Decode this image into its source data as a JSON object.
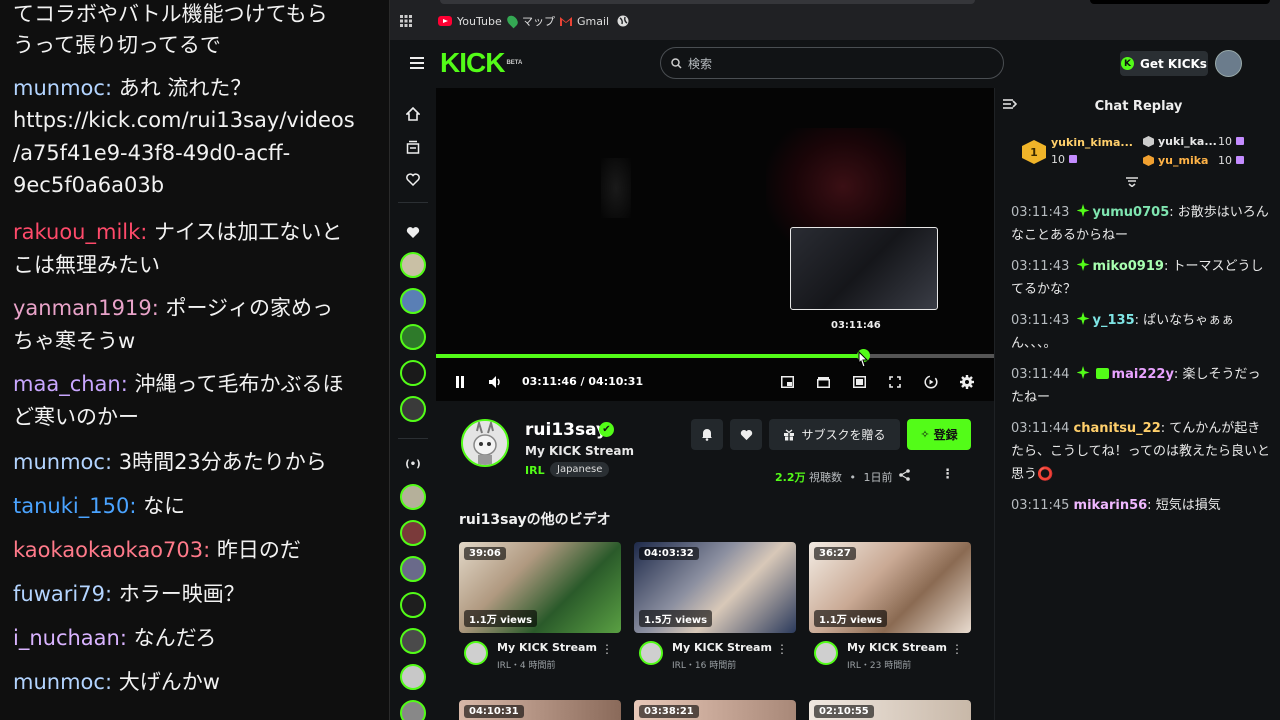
{
  "overlay_chat": {
    "messages": [
      {
        "user": "",
        "text": "てコラボやバトル機能つけてもら",
        "color": "#f2f2f2"
      },
      {
        "user": "",
        "text": "うって張り切ってるで",
        "color": "#f2f2f2"
      },
      {
        "user": "munmoc",
        "text": "あれ 流れた？",
        "color": "#b3d4ff"
      },
      {
        "user": "",
        "text": "https://kick.com/rui13say/videos",
        "color": "#f2f2f2"
      },
      {
        "user": "",
        "text": "/a75f41e9-43f8-49d0-acff-",
        "color": "#f2f2f2"
      },
      {
        "user": "",
        "text": "9ec5f0a6a03b",
        "color": "#f2f2f2"
      },
      {
        "user": "rakuou_milk",
        "text": "ナイスは加工ないと",
        "color": "#ff4a6a"
      },
      {
        "user": "",
        "text": "こは無理みたい",
        "color": "#f2f2f2"
      },
      {
        "user": "yanman1919",
        "text": "ポージィの家めっ",
        "color": "#e9a3c9"
      },
      {
        "user": "",
        "text": "ちゃ寒そうw",
        "color": "#f2f2f2"
      },
      {
        "user": "maa_chan",
        "text": "沖縄って毛布かぶるほ",
        "color": "#c9a7ff"
      },
      {
        "user": "",
        "text": "ど寒いのかー",
        "color": "#f2f2f2"
      },
      {
        "user": "munmoc",
        "text": "3時間23分あたりから",
        "color": "#b3d4ff"
      },
      {
        "user": "tanuki_150",
        "text": "なに",
        "color": "#4aa3ff"
      },
      {
        "user": "kaokaokaokao703",
        "text": "昨日のだ",
        "color": "#ff7a8a"
      },
      {
        "user": "fuwari79",
        "text": "ホラー映画？",
        "color": "#b3d4ff"
      },
      {
        "user": "i_nuchaan",
        "text": "なんだろ",
        "color": "#d9b3ff"
      },
      {
        "user": "munmoc",
        "text": "大げんかw",
        "color": "#b3d4ff"
      }
    ]
  },
  "bookmarks": [
    {
      "label": "YouTube",
      "icon": "youtube-icon"
    },
    {
      "label": "マップ",
      "icon": "maps-icon"
    },
    {
      "label": "Gmail",
      "icon": "gmail-icon"
    }
  ],
  "header": {
    "logo": "KICK",
    "logo_sup": "BETA",
    "search_placeholder": "検索",
    "get_kicks": "Get KICKs",
    "brand_color": "#53fc18"
  },
  "player": {
    "preview_time": "03:11:46",
    "time": "03:11:46 / 04:10:31",
    "progress": 0.766
  },
  "channel": {
    "name": "rui13say",
    "title": "My KICK Stream",
    "category": "IRL",
    "language": "Japanese",
    "gift_sub": "サブスクを贈る",
    "subscribe": "登録",
    "views": "2.2万",
    "views_label": "視聴数",
    "age": "1日前"
  },
  "other_videos": {
    "title": "rui13sayの他のビデオ",
    "items": [
      {
        "duration": "39:06",
        "views": "1.1万 views",
        "title": "My KICK Stream",
        "meta": "IRL・4 時間前"
      },
      {
        "duration": "04:03:32",
        "views": "1.5万 views",
        "title": "My KICK Stream",
        "meta": "IRL・16 時間前"
      },
      {
        "duration": "36:27",
        "views": "1.1万 views",
        "title": "My KICK Stream",
        "meta": "IRL・23 時間前"
      }
    ],
    "second_row": [
      "04:10:31",
      "03:38:21",
      "02:10:55"
    ]
  },
  "chat_replay": {
    "title": "Chat Replay",
    "gifters": [
      {
        "name": "yukin_kima...",
        "count": "10",
        "rank": "1"
      },
      {
        "name": "yuki_ka...",
        "count": "10"
      },
      {
        "name": "yu_mika",
        "count": "10"
      }
    ],
    "messages": [
      {
        "time": "03:11:43",
        "user": "yumu0705",
        "text": "お散歩はいろんなことあるからねー",
        "color": "#7fe5b0",
        "badge": "star"
      },
      {
        "time": "03:11:43",
        "user": "miko0919",
        "text": "トーマスどうしてるかな？",
        "color": "#a8ffb0",
        "badge": "star"
      },
      {
        "time": "03:11:43",
        "user": "y_135",
        "text": "ぱいなちゃぁぁん、、、。",
        "color": "#7fe5e5",
        "badge": "star"
      },
      {
        "time": "03:11:44",
        "user": "mai222y",
        "text": "楽しそうだったねー",
        "color": "#e9a3ff",
        "badge": "star-gift"
      },
      {
        "time": "03:11:44",
        "user": "chanitsu_22",
        "text": "てんかんが起きたら、こうしてね！ってのは教えたら良いと思う⭕",
        "color": "#ffcf6b",
        "badge": ""
      },
      {
        "time": "03:11:45",
        "user": "mikarin56",
        "text": "短気は損気",
        "color": "#f0b8ff",
        "badge": ""
      }
    ]
  }
}
